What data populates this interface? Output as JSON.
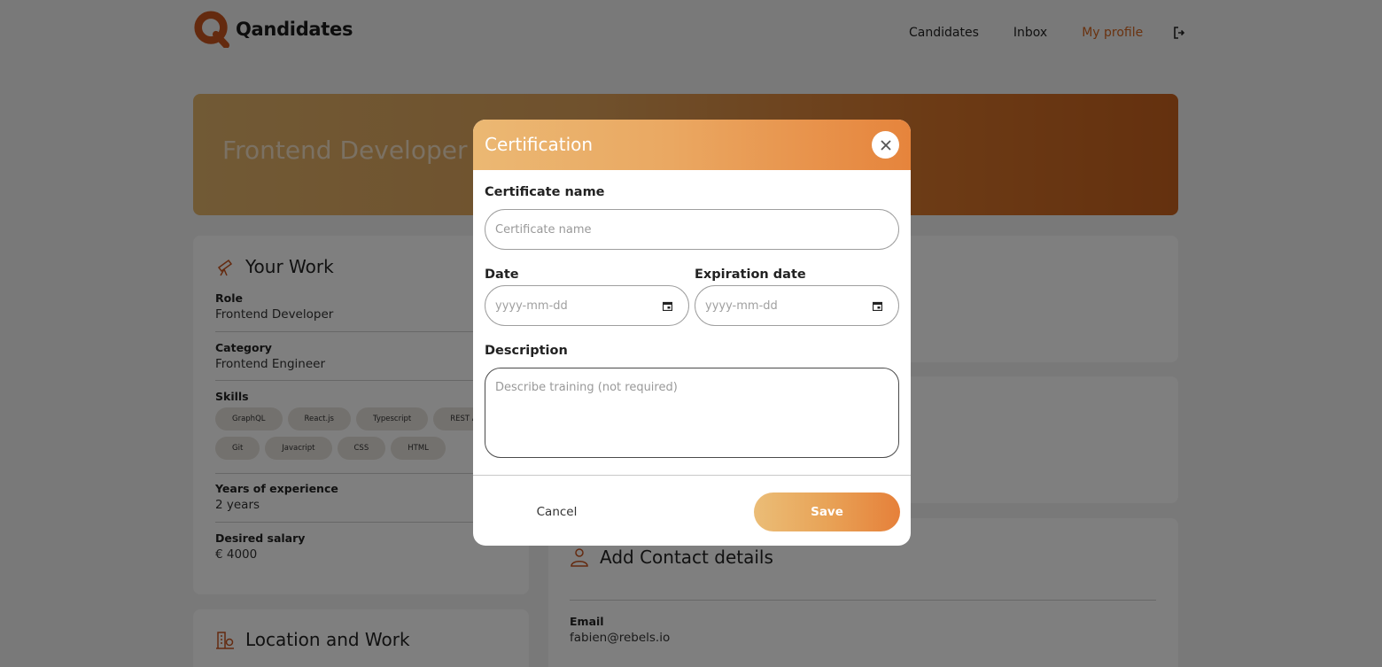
{
  "header": {
    "brand": "Qandidates",
    "nav": [
      {
        "label": "Candidates",
        "active": false
      },
      {
        "label": "Inbox",
        "active": false
      },
      {
        "label": "My profile",
        "active": true
      }
    ],
    "logout_icon": "logout-icon"
  },
  "hero": {
    "title": "Frontend Developer"
  },
  "work_card": {
    "title": "Your Work",
    "icon": "telescope-icon",
    "role_label": "Role",
    "role_value": "Frontend Developer",
    "category_label": "Category",
    "category_value": "Frontend Engineer",
    "skills_label": "Skills",
    "skills": [
      "GraphQL",
      "React.js",
      "Typescript",
      "REST API",
      "Git",
      "Javacript",
      "CSS",
      "HTML"
    ],
    "years_label": "Years of experience",
    "years_value": "2 years",
    "salary_label": "Desired salary",
    "salary_value": "€ 4000"
  },
  "location_card": {
    "title": "Location and Work",
    "icon": "building-location-icon"
  },
  "contact_card": {
    "title": "Add Contact details",
    "icon": "person-icon",
    "email_label": "Email",
    "email_value": "fabien@rebels.io"
  },
  "modal": {
    "title": "Certification",
    "close_icon": "close-icon",
    "cert_name_label": "Certificate name",
    "cert_name_placeholder": "Certificate name",
    "date_label": "Date",
    "date_placeholder": "yyyy-mm-dd",
    "exp_label": "Expiration date",
    "exp_placeholder": "yyyy-mm-dd",
    "desc_label": "Description",
    "desc_placeholder": "Describe training (not required)",
    "cancel_label": "Cancel",
    "save_label": "Save"
  },
  "colors": {
    "accent": "#e6843c",
    "nav_active": "#d4641f"
  }
}
